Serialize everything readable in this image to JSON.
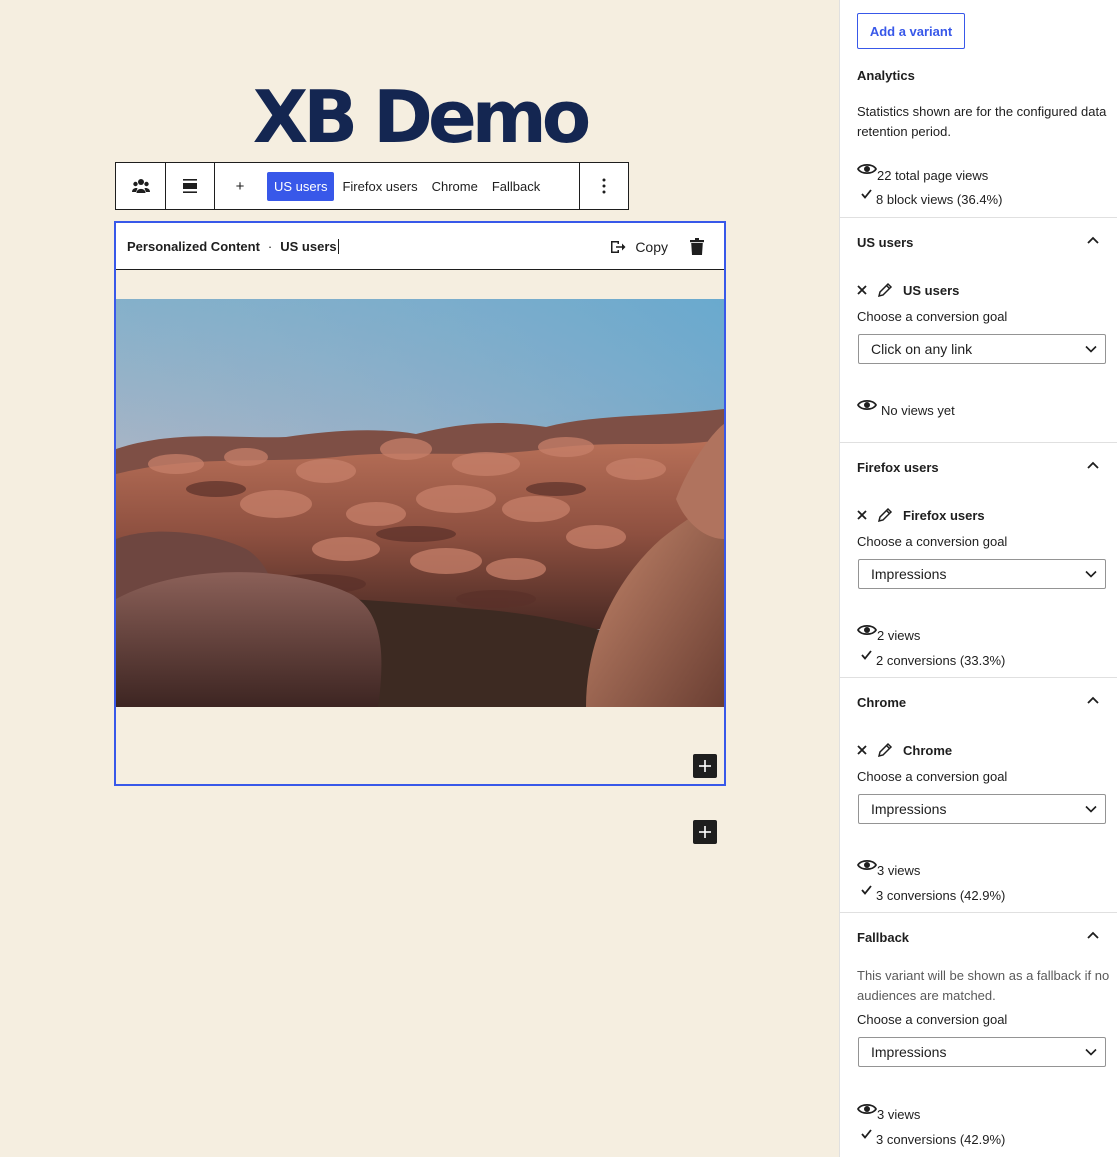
{
  "site": {
    "title": "XB Demo"
  },
  "toolbar": {
    "add_label": "+",
    "variants": [
      "US users",
      "Firefox users",
      "Chrome",
      "Fallback"
    ],
    "active_variant": "US users"
  },
  "block": {
    "title": "Personalized Content",
    "separator": "·",
    "variant": "US users",
    "copy_label": "Copy"
  },
  "sidebar": {
    "add_variant_label": "Add a variant",
    "analytics": {
      "title": "Analytics",
      "description": "Statistics shown are for the configured data retention period.",
      "page_views": "22 total page views",
      "block_views": "8 block views (36.4%)"
    },
    "goal_label": "Choose a conversion goal",
    "panels": [
      {
        "title": "US users",
        "name": "US users",
        "goal": "Click on any link",
        "views": "No views yet",
        "conversions": ""
      },
      {
        "title": "Firefox users",
        "name": "Firefox users",
        "goal": "Impressions",
        "views": "2 views",
        "conversions": "2 conversions (33.3%)"
      },
      {
        "title": "Chrome",
        "name": "Chrome",
        "goal": "Impressions",
        "views": "3 views",
        "conversions": "3 conversions (42.9%)"
      }
    ],
    "fallback": {
      "title": "Fallback",
      "note": "This variant will be shown as a fallback if no audiences are matched.",
      "goal": "Impressions",
      "views": "3 views",
      "conversions": "3 conversions (42.9%)"
    }
  },
  "colors": {
    "accent": "#3858e9",
    "title": "#142651",
    "canvas": "#f5eee0"
  }
}
